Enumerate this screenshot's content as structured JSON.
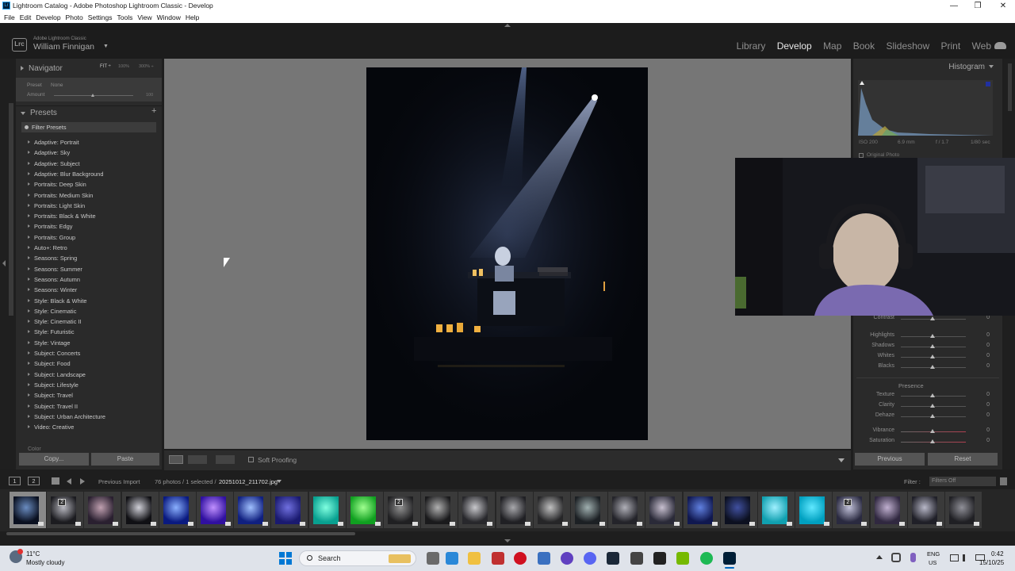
{
  "window": {
    "title": "Lightroom Catalog - Adobe Photoshop Lightroom Classic - Develop",
    "controls": {
      "minimize": "—",
      "maximize": "❐",
      "close": "✕"
    }
  },
  "menu": [
    "File",
    "Edit",
    "Develop",
    "Photo",
    "Settings",
    "Tools",
    "View",
    "Window",
    "Help"
  ],
  "identity": {
    "logo": "Lrc",
    "product": "Adobe Lightroom Classic",
    "user": "William Finnigan",
    "caret": "▼"
  },
  "modules": {
    "items": [
      "Library",
      "Develop",
      "Map",
      "Book",
      "Slideshow",
      "Print",
      "Web"
    ],
    "active": "Develop"
  },
  "navigator": {
    "title": "Navigator",
    "zoom": [
      "FIT ÷",
      "100%",
      "300% ÷"
    ]
  },
  "preset_amount": {
    "preset_label": "Preset",
    "preset_value": "None",
    "amount_label": "Amount",
    "amount_value": "100"
  },
  "presets": {
    "title": "Presets",
    "add": "+",
    "filter_label": "Filter Presets",
    "items": [
      "Adaptive: Portrait",
      "Adaptive: Sky",
      "Adaptive: Subject",
      "Adaptive: Blur Background",
      "Portraits: Deep Skin",
      "Portraits: Medium Skin",
      "Portraits: Light Skin",
      "Portraits: Black & White",
      "Portraits: Edgy",
      "Portraits: Group",
      "Auto+: Retro",
      "Seasons: Spring",
      "Seasons: Summer",
      "Seasons: Autumn",
      "Seasons: Winter",
      "Style: Black & White",
      "Style: Cinematic",
      "Style: Cinematic II",
      "Style: Futuristic",
      "Style: Vintage",
      "Subject: Concerts",
      "Subject: Food",
      "Subject: Landscape",
      "Subject: Lifestyle",
      "Subject: Travel",
      "Subject: Travel II",
      "Subject: Urban Architecture",
      "Video: Creative"
    ],
    "partial_item": "Color"
  },
  "left_buttons": {
    "copy": "Copy...",
    "paste": "Paste"
  },
  "toolbar": {
    "soft_proofing": "Soft Proofing"
  },
  "histogram": {
    "title": "Histogram",
    "iso": "ISO 200",
    "focal": "6.9 mm",
    "aperture": "f / 1.7",
    "shutter": "1/80 sec",
    "original_photo": "Original Photo"
  },
  "basic": {
    "tone": [
      {
        "label": "Contrast",
        "value": "0"
      },
      {
        "label": "Highlights",
        "value": "0"
      },
      {
        "label": "Shadows",
        "value": "0"
      },
      {
        "label": "Whites",
        "value": "0"
      },
      {
        "label": "Blacks",
        "value": "0"
      }
    ],
    "presence_title": "Presence",
    "presence": [
      {
        "label": "Texture",
        "value": "0"
      },
      {
        "label": "Clarity",
        "value": "0"
      },
      {
        "label": "Dehaze",
        "value": "0"
      },
      {
        "label": "Vibrance",
        "value": "0"
      },
      {
        "label": "Saturation",
        "value": "0"
      }
    ]
  },
  "right_buttons": {
    "previous": "Previous",
    "reset": "Reset"
  },
  "filmstrip_bar": {
    "view1": "1",
    "view2": "2",
    "source": "Previous Import",
    "count": "76 photos / 1 selected /",
    "filename": "20251012_211702.jpg",
    "filter_label": "Filter :",
    "filter_value": "Filters Off"
  },
  "thumbs": [
    {
      "c1": "#0a1020",
      "c2": "#6a8cc0",
      "badge": ""
    },
    {
      "c1": "#1c1c20",
      "c2": "#b8b8c0",
      "badge": "2"
    },
    {
      "c1": "#2a2030",
      "c2": "#c0a0b0",
      "badge": ""
    },
    {
      "c1": "#101014",
      "c2": "#d0d0d8",
      "badge": ""
    },
    {
      "c1": "#0a1a80",
      "c2": "#8ab0ff",
      "badge": ""
    },
    {
      "c1": "#3010a0",
      "c2": "#c090ff",
      "badge": ""
    },
    {
      "c1": "#102080",
      "c2": "#a0c0ff",
      "badge": ""
    },
    {
      "c1": "#1a1a70",
      "c2": "#7070e0",
      "badge": ""
    },
    {
      "c1": "#08a090",
      "c2": "#80ffe0",
      "badge": ""
    },
    {
      "c1": "#10a020",
      "c2": "#a0ff90",
      "badge": ""
    },
    {
      "c1": "#202022",
      "c2": "#909090",
      "badge": "2"
    },
    {
      "c1": "#1a1a1c",
      "c2": "#b0b0b0",
      "badge": ""
    },
    {
      "c1": "#28282c",
      "c2": "#c8c8cc",
      "badge": ""
    },
    {
      "c1": "#202024",
      "c2": "#a8a8ac",
      "badge": ""
    },
    {
      "c1": "#262628",
      "c2": "#c0c0c0",
      "badge": ""
    },
    {
      "c1": "#1c2024",
      "c2": "#a0b0b0",
      "badge": ""
    },
    {
      "c1": "#24242a",
      "c2": "#b0b0b8",
      "badge": ""
    },
    {
      "c1": "#2a2a38",
      "c2": "#c8c0d0",
      "badge": ""
    },
    {
      "c1": "#101850",
      "c2": "#6080e0",
      "badge": ""
    },
    {
      "c1": "#0c1020",
      "c2": "#4050a0",
      "badge": ""
    },
    {
      "c1": "#10a0b0",
      "c2": "#a0f0ff",
      "badge": ""
    },
    {
      "c1": "#00a0c0",
      "c2": "#60e8ff",
      "badge": ""
    },
    {
      "c1": "#2a2a40",
      "c2": "#c0c0d8",
      "badge": "2"
    },
    {
      "c1": "#302840",
      "c2": "#c0b0d0",
      "badge": ""
    },
    {
      "c1": "#202028",
      "c2": "#b8b8c8",
      "badge": ""
    },
    {
      "c1": "#202024",
      "c2": "#909098",
      "badge": ""
    }
  ],
  "taskbar": {
    "temp": "11°C",
    "weather": "Mostly cloudy",
    "search": "Search",
    "lang1": "ENG",
    "lang2": "US",
    "time": "0:42",
    "date": "15/10/25"
  },
  "colors": {
    "accent_active": "#e8e8e8",
    "panel": "#2a2a2a",
    "canvas": "#767676"
  }
}
